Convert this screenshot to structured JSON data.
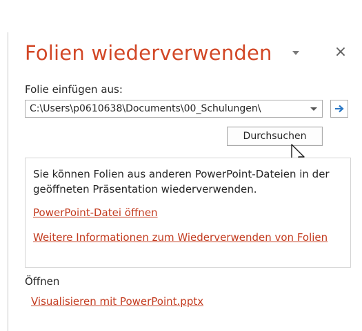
{
  "pane": {
    "title": "Folien wiederverwenden",
    "accent_color": "#d24726",
    "close_label": "×",
    "menu_icon": "caret-down-icon"
  },
  "insert_from": {
    "label": "Folie einfügen aus:",
    "path_value": "C:\\Users\\p0610638\\Documents\\00_Schulungen\\",
    "go_icon": "arrow-right-icon",
    "browse_label": "Durchsuchen"
  },
  "info": {
    "text": "Sie können Folien aus anderen PowerPoint-Dateien in der geöffneten Präsentation wiederverwenden.",
    "link_open": "PowerPoint-Datei öffnen",
    "link_more": "Weitere Informationen zum Wiederverwenden von Folien",
    "link_color": "#c33b1f"
  },
  "recent": {
    "heading": "Öffnen",
    "files": [
      "Visualisieren mit PowerPoint.pptx"
    ]
  }
}
